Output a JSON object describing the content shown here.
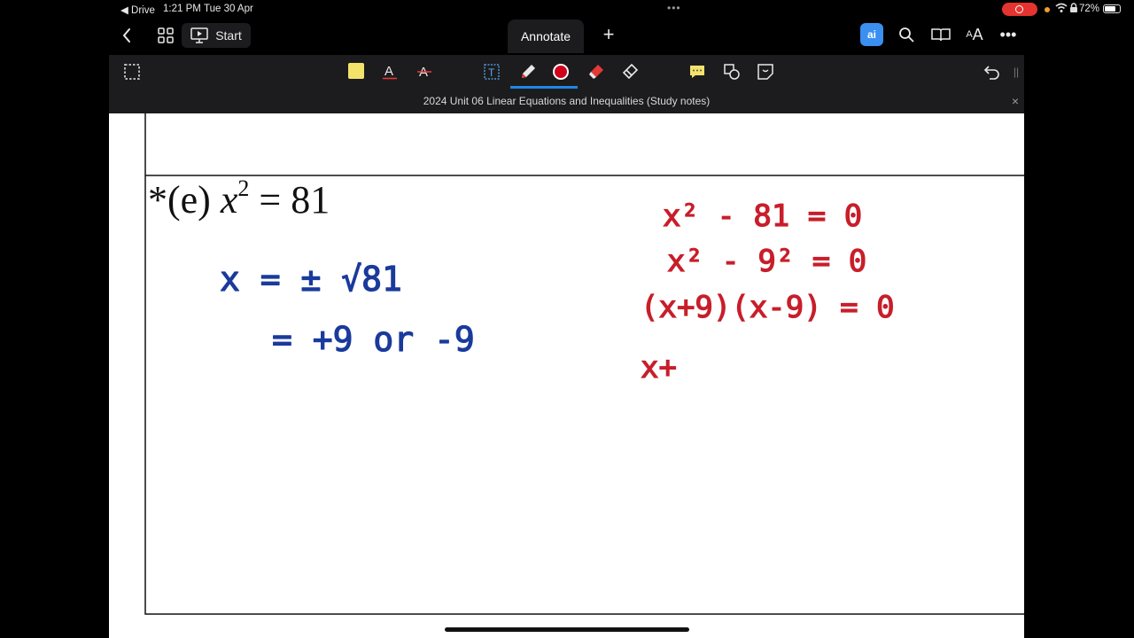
{
  "status_bar": {
    "back_app": "◀ Drive",
    "time": "1:21 PM",
    "date": "Tue 30 Apr",
    "battery_pct": "72%"
  },
  "toolbar": {
    "start_label": "Start",
    "annotate_tab": "Annotate",
    "ai_label": "ai"
  },
  "document": {
    "title": "2024 Unit 06 Linear Equations and Inequalities (Study notes)"
  },
  "question": {
    "prefix": "*(e) ",
    "var": "x",
    "exp": "2",
    "rest": " = 81"
  },
  "handwriting": {
    "blue": [
      "x = ± √81",
      "= +9 or -9"
    ],
    "red": [
      "x² - 81 = 0",
      "x² - 9² = 0",
      "(x+9)(x-9) = 0",
      "x+"
    ],
    "blue_color": "#1a3a9c",
    "red_color": "#c81e2a"
  }
}
